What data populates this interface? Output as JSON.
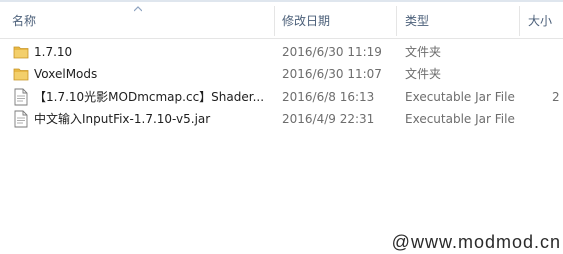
{
  "columns": {
    "name": "名称",
    "modified": "修改日期",
    "type": "类型",
    "size": "大小"
  },
  "files": [
    {
      "name": "1.7.10",
      "modified": "2016/6/30 11:19",
      "type": "文件夹",
      "size": "",
      "icon": "folder-icon"
    },
    {
      "name": "VoxelMods",
      "modified": "2016/6/30 11:07",
      "type": "文件夹",
      "size": "",
      "icon": "folder-icon"
    },
    {
      "name": "【1.7.10光影MODmcmap.cc】Shader...",
      "modified": "2016/6/8 16:13",
      "type": "Executable Jar File",
      "size": "2",
      "icon": "jar-file-icon"
    },
    {
      "name": "中文输入InputFix-1.7.10-v5.jar",
      "modified": "2016/4/9 22:31",
      "type": "Executable Jar File",
      "size": "",
      "icon": "jar-file-icon"
    }
  ],
  "watermark": "@www.modmod.cn",
  "colors": {
    "header_text": "#4c607a",
    "folder": "#e8b845",
    "sort_arrow": "#8ea3c1"
  }
}
